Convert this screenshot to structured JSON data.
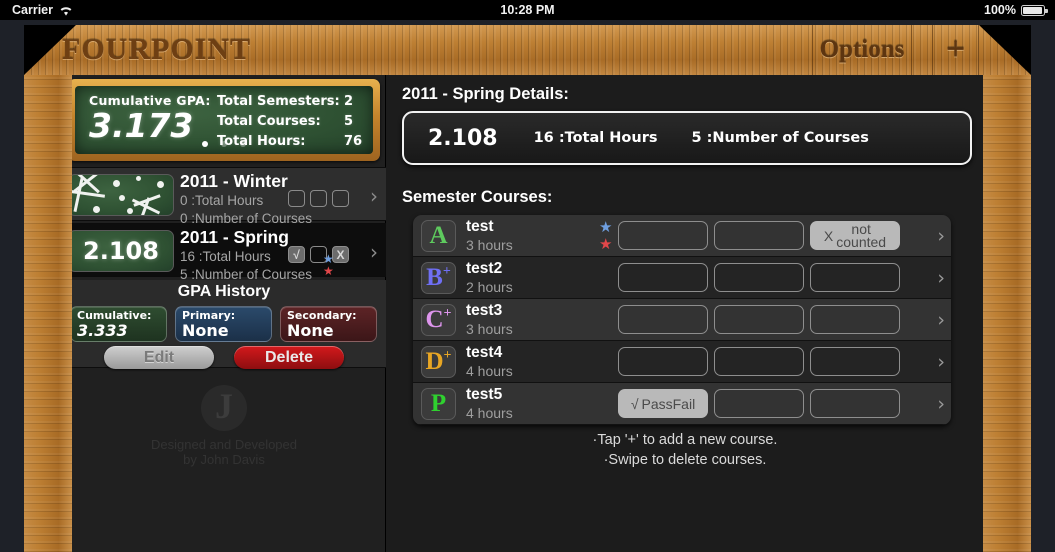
{
  "status_bar": {
    "carrier": "Carrier",
    "wifi_icon": "wifi-icon",
    "time": "10:28 PM",
    "battery_pct": "100%",
    "battery_icon": "battery-icon"
  },
  "nav": {
    "app_title": "FOURPOINT",
    "options_label": "Options",
    "add_label": "+"
  },
  "sidebar": {
    "summary": {
      "cumulative_label": "Cumulative GPA:",
      "cumulative_value": "3.173",
      "stats": [
        {
          "label": "Total Semesters:",
          "value": "2"
        },
        {
          "label": "Total Courses:",
          "value": "5"
        },
        {
          "label": "Total Hours:",
          "value": "76"
        }
      ],
      "page_dots": 3,
      "page_active": 0
    },
    "semesters": [
      {
        "title": "2011 - Winter",
        "hours_line": "0 :Total Hours",
        "courses_line": "0 :Number of Courses",
        "thumb_type": "snowflakes",
        "thumb_value": "",
        "boxes": [
          "",
          "",
          ""
        ],
        "stars": [],
        "selected": false,
        "chevron_icon": "chevron-right-icon"
      },
      {
        "title": "2011 - Spring",
        "hours_line": "16 :Total Hours",
        "courses_line": "5 :Number of Courses",
        "thumb_type": "gpa",
        "thumb_value": "2.108",
        "boxes": [
          "√",
          "",
          "X"
        ],
        "stars": [
          "blue",
          "red"
        ],
        "selected": true,
        "chevron_icon": "chevron-right-icon"
      }
    ],
    "gpa_history": {
      "heading": "GPA History",
      "chips": [
        {
          "label": "Cumulative:",
          "value": "3.333",
          "color": "#2f4d31"
        },
        {
          "label": "Primary:",
          "value": "None",
          "color": "#2b4a6b"
        },
        {
          "label": "Secondary:",
          "value": "None",
          "color": "#5d2426"
        }
      ],
      "edit_label": "Edit",
      "delete_label": "Delete"
    },
    "footer": {
      "logo_letter": "J",
      "line1": "Designed and Developed",
      "line2": "by John Davis"
    }
  },
  "detail": {
    "title": "2011 - Spring Details:",
    "summary": {
      "gpa": "2.108",
      "hours": "16 :Total Hours",
      "courses": "5 :Number of Courses"
    },
    "courses_heading": "Semester Courses:",
    "courses": [
      {
        "grade": "A",
        "grade_plus": "",
        "grade_color": "#5ecb5e",
        "name": "test",
        "hours": "3 hours",
        "stars": [
          "blue",
          "red"
        ],
        "slots": [
          {
            "type": "empty",
            "label": ""
          },
          {
            "type": "empty",
            "label": ""
          },
          {
            "type": "pill",
            "label": "X not counted",
            "mark": "X",
            "line1": "not",
            "line2": "counted"
          }
        ],
        "chevron_icon": "chevron-right-icon"
      },
      {
        "grade": "B",
        "grade_plus": "+",
        "grade_color": "#6f6ff5",
        "name": "test2",
        "hours": "2 hours",
        "stars": [],
        "slots": [
          {
            "type": "empty",
            "label": ""
          },
          {
            "type": "empty",
            "label": ""
          },
          {
            "type": "empty",
            "label": ""
          }
        ],
        "chevron_icon": "chevron-right-icon"
      },
      {
        "grade": "C",
        "grade_plus": "+",
        "grade_color": "#dd95ec",
        "name": "test3",
        "hours": "3 hours",
        "stars": [],
        "slots": [
          {
            "type": "empty",
            "label": ""
          },
          {
            "type": "empty",
            "label": ""
          },
          {
            "type": "empty",
            "label": ""
          }
        ],
        "chevron_icon": "chevron-right-icon"
      },
      {
        "grade": "D",
        "grade_plus": "+",
        "grade_color": "#e8a624",
        "name": "test4",
        "hours": "4 hours",
        "stars": [],
        "slots": [
          {
            "type": "empty",
            "label": ""
          },
          {
            "type": "empty",
            "label": ""
          },
          {
            "type": "empty",
            "label": ""
          }
        ],
        "chevron_icon": "chevron-right-icon"
      },
      {
        "grade": "P",
        "grade_plus": "",
        "grade_color": "#2fd12f",
        "name": "test5",
        "hours": "4 hours",
        "stars": [],
        "slots": [
          {
            "type": "pill",
            "label": "√ PassFail",
            "mark": "√",
            "line1": "PassFail",
            "line2": ""
          },
          {
            "type": "empty",
            "label": ""
          },
          {
            "type": "empty",
            "label": ""
          }
        ],
        "chevron_icon": "chevron-right-icon"
      }
    ],
    "hints": {
      "line1": "·Tap '+' to add a new course.",
      "line2": "·Swipe to delete courses."
    }
  },
  "colors": {
    "wood": "#b9792e",
    "chalkboard": "#2f5233",
    "star_blue": "#6f9fe0",
    "star_red": "#e2474a",
    "delete_red": "#d4191c"
  }
}
